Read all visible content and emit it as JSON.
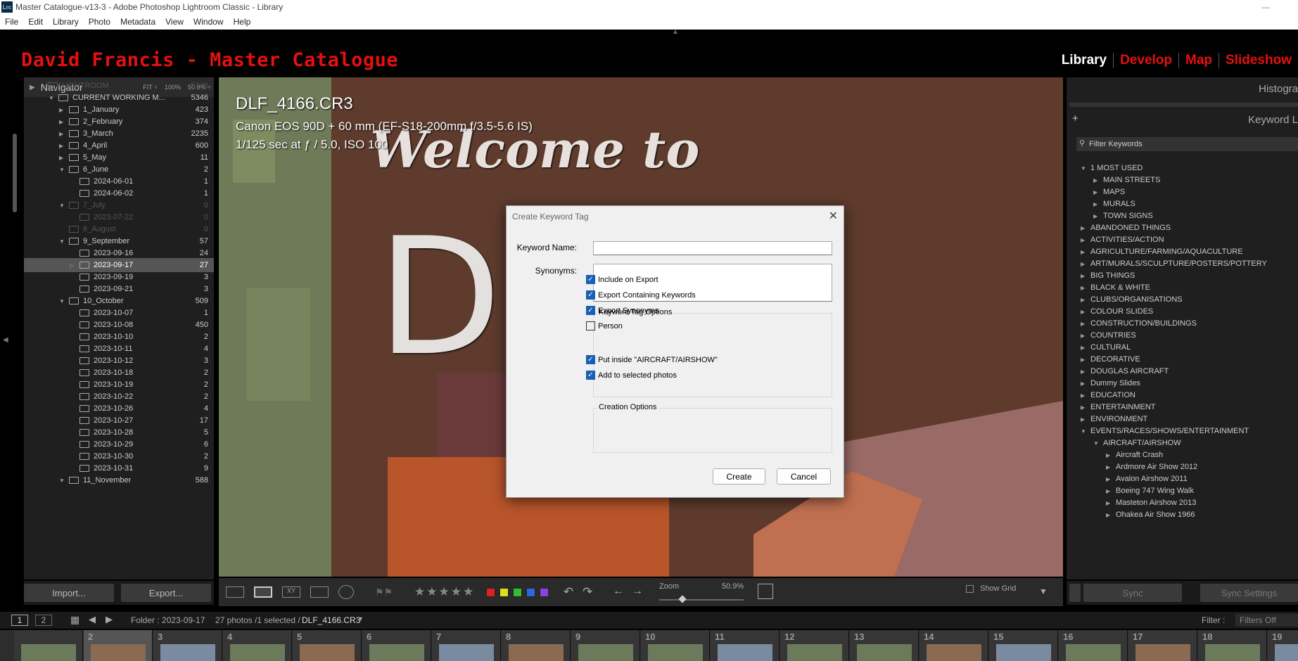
{
  "window": {
    "title": "Master Catalogue-v13-3 - Adobe Photoshop Lightroom Classic - Library",
    "app_icon": "Lrc"
  },
  "menu": [
    "File",
    "Edit",
    "Library",
    "Photo",
    "Metadata",
    "View",
    "Window",
    "Help"
  ],
  "identity_plate": "David Francis - Master Catalogue",
  "modules": [
    "Library",
    "Develop",
    "Map",
    "Slideshow"
  ],
  "navigator": {
    "title": "Navigator",
    "options": [
      "FIT ÷",
      "100%",
      "50.9% ÷"
    ]
  },
  "folders": [
    {
      "name": "LIGHTROOM",
      "count": "5346",
      "level": 0,
      "arrow": "",
      "state": "dim"
    },
    {
      "name": "CURRENT WORKING M...",
      "count": "5346",
      "level": 1,
      "arrow": "▼",
      "state": ""
    },
    {
      "name": "1_January",
      "count": "423",
      "level": 2,
      "arrow": "▶",
      "state": ""
    },
    {
      "name": "2_February",
      "count": "374",
      "level": 2,
      "arrow": "▶",
      "state": ""
    },
    {
      "name": "3_March",
      "count": "2235",
      "level": 2,
      "arrow": "▶",
      "state": ""
    },
    {
      "name": "4_April",
      "count": "600",
      "level": 2,
      "arrow": "▶",
      "state": ""
    },
    {
      "name": "5_May",
      "count": "11",
      "level": 2,
      "arrow": "▶",
      "state": ""
    },
    {
      "name": "6_June",
      "count": "2",
      "level": 2,
      "arrow": "▼",
      "state": ""
    },
    {
      "name": "2024-06-01",
      "count": "1",
      "level": 3,
      "arrow": "",
      "state": ""
    },
    {
      "name": "2024-06-02",
      "count": "1",
      "level": 3,
      "arrow": "",
      "state": ""
    },
    {
      "name": "7_July",
      "count": "0",
      "level": 2,
      "arrow": "▼",
      "state": "dim"
    },
    {
      "name": "2023-07-22",
      "count": "0",
      "level": 3,
      "arrow": "",
      "state": "dim"
    },
    {
      "name": "8_August",
      "count": "0",
      "level": 2,
      "arrow": "",
      "state": "dim"
    },
    {
      "name": "9_September",
      "count": "57",
      "level": 2,
      "arrow": "▼",
      "state": ""
    },
    {
      "name": "2023-09-16",
      "count": "24",
      "level": 3,
      "arrow": "",
      "state": ""
    },
    {
      "name": "2023-09-17",
      "count": "27",
      "level": 3,
      "arrow": "▷",
      "state": "sel"
    },
    {
      "name": "2023-09-19",
      "count": "3",
      "level": 3,
      "arrow": "",
      "state": ""
    },
    {
      "name": "2023-09-21",
      "count": "3",
      "level": 3,
      "arrow": "",
      "state": ""
    },
    {
      "name": "10_October",
      "count": "509",
      "level": 2,
      "arrow": "▼",
      "state": ""
    },
    {
      "name": "2023-10-07",
      "count": "1",
      "level": 3,
      "arrow": "",
      "state": ""
    },
    {
      "name": "2023-10-08",
      "count": "450",
      "level": 3,
      "arrow": "",
      "state": ""
    },
    {
      "name": "2023-10-10",
      "count": "2",
      "level": 3,
      "arrow": "",
      "state": ""
    },
    {
      "name": "2023-10-11",
      "count": "4",
      "level": 3,
      "arrow": "",
      "state": ""
    },
    {
      "name": "2023-10-12",
      "count": "3",
      "level": 3,
      "arrow": "",
      "state": ""
    },
    {
      "name": "2023-10-18",
      "count": "2",
      "level": 3,
      "arrow": "",
      "state": ""
    },
    {
      "name": "2023-10-19",
      "count": "2",
      "level": 3,
      "arrow": "",
      "state": ""
    },
    {
      "name": "2023-10-22",
      "count": "2",
      "level": 3,
      "arrow": "",
      "state": ""
    },
    {
      "name": "2023-10-26",
      "count": "4",
      "level": 3,
      "arrow": "",
      "state": ""
    },
    {
      "name": "2023-10-27",
      "count": "17",
      "level": 3,
      "arrow": "",
      "state": ""
    },
    {
      "name": "2023-10-28",
      "count": "5",
      "level": 3,
      "arrow": "",
      "state": ""
    },
    {
      "name": "2023-10-29",
      "count": "6",
      "level": 3,
      "arrow": "",
      "state": ""
    },
    {
      "name": "2023-10-30",
      "count": "2",
      "level": 3,
      "arrow": "",
      "state": ""
    },
    {
      "name": "2023-10-31",
      "count": "9",
      "level": 3,
      "arrow": "",
      "state": ""
    },
    {
      "name": "11_November",
      "count": "588",
      "level": 2,
      "arrow": "▼",
      "state": ""
    }
  ],
  "left_buttons": {
    "import": "Import...",
    "export": "Export..."
  },
  "photo_info": {
    "filename": "DLF_4166.CR3",
    "camera": "Canon EOS 90D + 60 mm (EF-S18-200mm f/3.5-5.6 IS)",
    "exposure": "1/125 sec at ƒ / 5.0, ISO 100",
    "sign_text": "Welcome to",
    "sign_letter": "D"
  },
  "toolbar": {
    "zoom_label": "Zoom",
    "zoom_value": "50.9%",
    "show_grid": "Show Grid",
    "stars": "★★★★★",
    "color_labels": [
      "#d22",
      "#dd2",
      "#3b3",
      "#36d",
      "#84d"
    ]
  },
  "right_panel": {
    "histogram": "Histogra",
    "keyword_list": "Keyword L",
    "filter_placeholder": "Filter Keywords",
    "plus": "+"
  },
  "keywords": [
    {
      "name": "1 MOST USED",
      "level": 0,
      "arrow": "▼"
    },
    {
      "name": "MAIN STREETS",
      "level": 1,
      "arrow": "▶"
    },
    {
      "name": "MAPS",
      "level": 1,
      "arrow": "▶"
    },
    {
      "name": "MURALS",
      "level": 1,
      "arrow": "▶"
    },
    {
      "name": "TOWN SIGNS",
      "level": 1,
      "arrow": "▶"
    },
    {
      "name": "ABANDONED THINGS",
      "level": 0,
      "arrow": "▶"
    },
    {
      "name": "ACTIVITIES/ACTION",
      "level": 0,
      "arrow": "▶"
    },
    {
      "name": "AGRICULTURE/FARMING/AQUACULTURE",
      "level": 0,
      "arrow": "▶"
    },
    {
      "name": "ART/MURALS/SCULPTURE/POSTERS/POTTERY",
      "level": 0,
      "arrow": "▶"
    },
    {
      "name": "BIG THINGS",
      "level": 0,
      "arrow": "▶"
    },
    {
      "name": "BLACK & WHITE",
      "level": 0,
      "arrow": "▶"
    },
    {
      "name": "CLUBS/ORGANISATIONS",
      "level": 0,
      "arrow": "▶"
    },
    {
      "name": "COLOUR SLIDES",
      "level": 0,
      "arrow": "▶"
    },
    {
      "name": "CONSTRUCTION/BUILDINGS",
      "level": 0,
      "arrow": "▶"
    },
    {
      "name": "COUNTRIES",
      "level": 0,
      "arrow": "▶"
    },
    {
      "name": "CULTURAL",
      "level": 0,
      "arrow": "▶"
    },
    {
      "name": "DECORATIVE",
      "level": 0,
      "arrow": "▶"
    },
    {
      "name": "DOUGLAS AIRCRAFT",
      "level": 0,
      "arrow": "▶"
    },
    {
      "name": "Dummy Slides",
      "level": 0,
      "arrow": "▶"
    },
    {
      "name": "EDUCATION",
      "level": 0,
      "arrow": "▶"
    },
    {
      "name": "ENTERTAINMENT",
      "level": 0,
      "arrow": "▶"
    },
    {
      "name": "ENVIRONMENT",
      "level": 0,
      "arrow": "▶"
    },
    {
      "name": "EVENTS/RACES/SHOWS/ENTERTAINMENT",
      "level": 0,
      "arrow": "▼"
    },
    {
      "name": "AIRCRAFT/AIRSHOW",
      "level": 1,
      "arrow": "▼"
    },
    {
      "name": "Aircraft Crash",
      "level": 2,
      "arrow": "▶"
    },
    {
      "name": "Ardmore Air Show 2012",
      "level": 2,
      "arrow": "▶"
    },
    {
      "name": "Avalon Airshow 2011",
      "level": 2,
      "arrow": "▶"
    },
    {
      "name": "Boeing 747 Wing Walk",
      "level": 2,
      "arrow": "▶"
    },
    {
      "name": "Masteton Airshow 2013",
      "level": 2,
      "arrow": "▶"
    },
    {
      "name": "Ohakea Air Show 1966",
      "level": 2,
      "arrow": "▶"
    }
  ],
  "right_buttons": {
    "sync": "Sync",
    "sync_settings": "Sync Settings"
  },
  "filmstrip_bar": {
    "page1": "1",
    "page2": "2",
    "folder": "Folder : 2023-09-17",
    "count": "27 photos /1 selected /",
    "file": "DLF_4166.CR3",
    "filter_label": "Filter :",
    "filter_value": "Filters Off"
  },
  "filmstrip": [
    "",
    "2",
    "3",
    "4",
    "5",
    "6",
    "7",
    "8",
    "9",
    "10",
    "11",
    "12",
    "13",
    "14",
    "15",
    "16",
    "17",
    "18",
    "19"
  ],
  "dialog": {
    "title": "Create Keyword Tag",
    "keyword_name_label": "Keyword Name:",
    "keyword_name_value": "",
    "synonyms_label": "Synonyms:",
    "tag_options_label": "Keyword Tag Options",
    "tag_options": [
      {
        "label": "Include on Export",
        "checked": true
      },
      {
        "label": "Export Containing Keywords",
        "checked": true
      },
      {
        "label": "Export Synonyms",
        "checked": true
      },
      {
        "label": "Person",
        "checked": false
      }
    ],
    "creation_label": "Creation Options",
    "creation_options": [
      {
        "label": "Put inside \"AIRCRAFT/AIRSHOW\"",
        "checked": true
      },
      {
        "label": "Add to selected photos",
        "checked": true
      }
    ],
    "create": "Create",
    "cancel": "Cancel"
  }
}
